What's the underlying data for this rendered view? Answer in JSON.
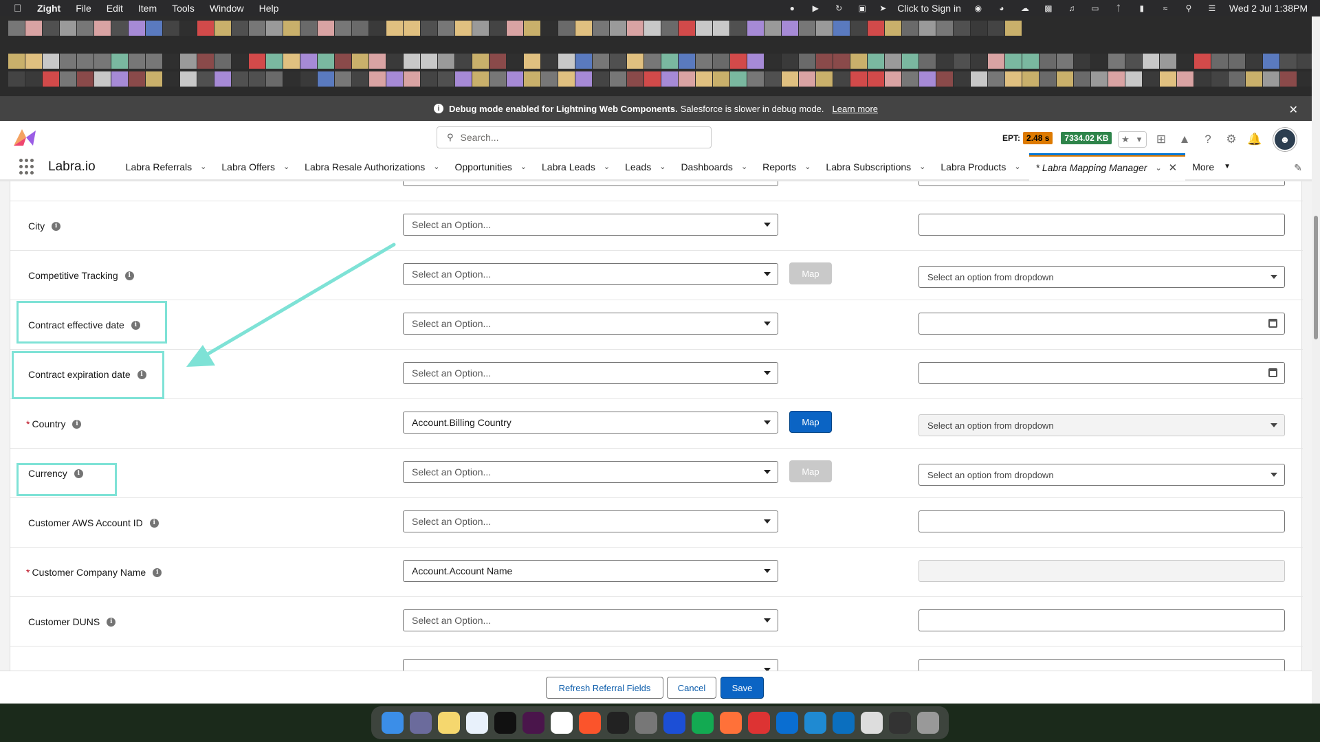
{
  "menubar": {
    "app_name": "Zight",
    "items": [
      "File",
      "Edit",
      "Item",
      "Tools",
      "Window",
      "Help"
    ],
    "sign_in": "Click to Sign in",
    "datetime": "Wed 2 Jul  1:38PM"
  },
  "debug_banner": {
    "bold": "Debug mode enabled for Lightning Web Components.",
    "text": "Salesforce is slower in debug mode.",
    "link": "Learn more"
  },
  "header": {
    "search_placeholder": "Search...",
    "ept_label": "EPT:",
    "ept_value": "2.48 s",
    "memory": "7334.02 KB"
  },
  "nav": {
    "app_name": "Labra.io",
    "tabs": [
      {
        "label": "Labra Referrals"
      },
      {
        "label": "Labra Offers"
      },
      {
        "label": "Labra Resale Authorizations"
      },
      {
        "label": "Opportunities"
      },
      {
        "label": "Labra Leads"
      },
      {
        "label": "Leads"
      },
      {
        "label": "Dashboards"
      },
      {
        "label": "Reports"
      },
      {
        "label": "Labra Subscriptions"
      },
      {
        "label": "Labra Products"
      }
    ],
    "active_tab": "* Labra Mapping Manager",
    "more": "More"
  },
  "rows": [
    {
      "label": "City",
      "required": "",
      "select": "Select an Option..."
    },
    {
      "label": "Competitive Tracking",
      "required": "",
      "select": "Select an Option...",
      "map": "Map",
      "right": "Select an option from dropdown"
    },
    {
      "label": "Contract effective date",
      "required": "",
      "select": "Select an Option..."
    },
    {
      "label": "Contract expiration date",
      "required": "",
      "select": "Select an Option..."
    },
    {
      "label": "Country",
      "required": "*",
      "select": "Account.Billing Country",
      "map": "Map",
      "right": "Select an option from dropdown"
    },
    {
      "label": "Currency",
      "required": "",
      "select": "Select an Option...",
      "map": "Map",
      "right": "Select an option from dropdown"
    },
    {
      "label": "Customer AWS Account ID",
      "required": "",
      "select": "Select an Option..."
    },
    {
      "label": "Customer Company Name",
      "required": "*",
      "select": "Account.Account Name"
    },
    {
      "label": "Customer DUNS",
      "required": "",
      "select": "Select an Option..."
    }
  ],
  "footer": {
    "refresh": "Refresh Referral Fields",
    "cancel": "Cancel",
    "save": "Save"
  },
  "colors": {
    "brand": "#0b64c4",
    "highlight": "#7ee2d6",
    "ept_badge": "#dd7a01",
    "memory_badge": "#2e844a"
  }
}
